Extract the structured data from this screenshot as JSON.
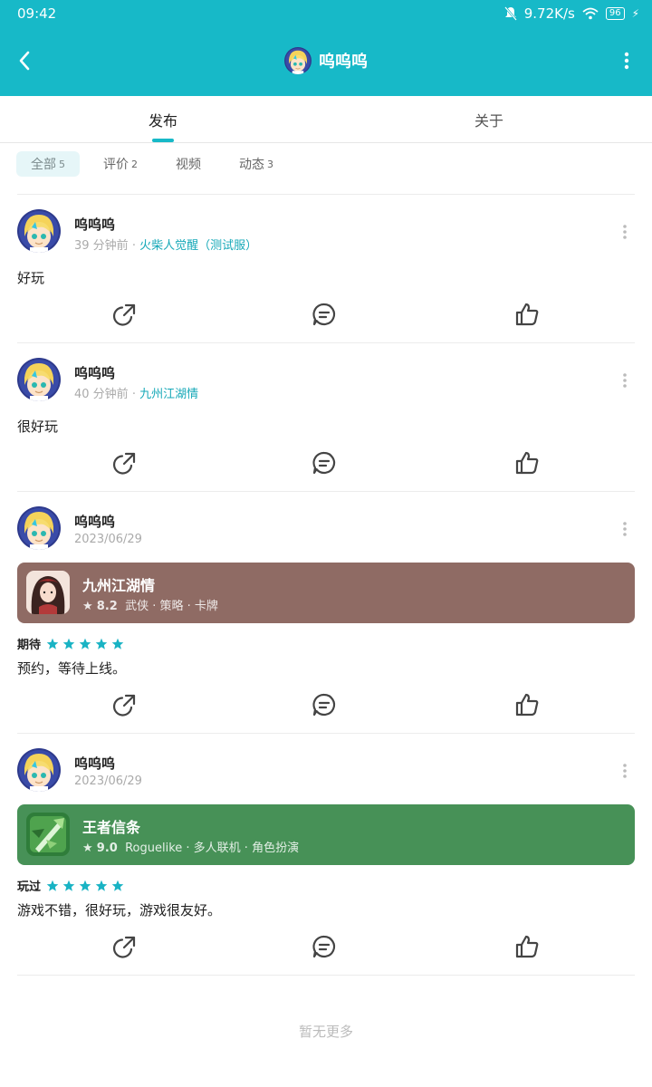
{
  "status": {
    "time": "09:42",
    "speed": "9.72K/s",
    "battery": "96"
  },
  "header": {
    "title": "呜呜呜"
  },
  "tabs": [
    {
      "label": "发布"
    },
    {
      "label": "关于"
    }
  ],
  "filters": [
    {
      "label": "全部",
      "count": "5"
    },
    {
      "label": "评价",
      "count": "2"
    },
    {
      "label": "视频",
      "count": ""
    },
    {
      "label": "动态",
      "count": "3"
    }
  ],
  "posts": [
    {
      "name": "呜呜呜",
      "time": "39 分钟前",
      "sep": "·",
      "game_link": "火柴人觉醒（测试服）",
      "text": "好玩"
    },
    {
      "name": "呜呜呜",
      "time": "40 分钟前",
      "sep": "·",
      "game_link": "九州江湖情",
      "text": "很好玩"
    },
    {
      "name": "呜呜呜",
      "time": "2023/06/29",
      "rating_label": "期待",
      "text": "预约，等待上线。",
      "game": {
        "title": "九州江湖情",
        "score": "8.2",
        "tags": "武侠 · 策略 · 卡牌",
        "color": "#8f6b64"
      }
    },
    {
      "name": "呜呜呜",
      "time": "2023/06/29",
      "rating_label": "玩过",
      "text": "游戏不错，很好玩，游戏很友好。",
      "game": {
        "title": "王者信条",
        "score": "9.0",
        "tags": "Roguelike · 多人联机 · 角色扮演",
        "color": "#479157"
      }
    }
  ],
  "footer": {
    "no_more": "暂无更多"
  },
  "colors": {
    "accent": "#17b9c8",
    "link": "#17a9b8"
  }
}
